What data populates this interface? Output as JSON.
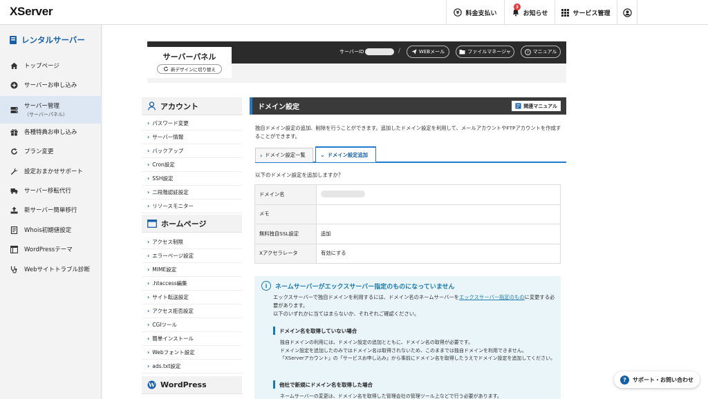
{
  "app": {
    "logo": "XServer"
  },
  "topbar": {
    "payment_label": "料金支払い",
    "notice_label": "お知らせ",
    "notice_count": "3",
    "service_label": "サービス管理"
  },
  "sidebar": {
    "title": "レンタルサーバー",
    "items": [
      {
        "label": "トップページ",
        "icon": "home-icon"
      },
      {
        "label": "サーバーお申し込み",
        "icon": "plus-circle-icon"
      },
      {
        "label": "サーバー管理",
        "sub": "（サーバーパネル）",
        "icon": "server-icon",
        "active": true
      },
      {
        "label": "各種特典お申し込み",
        "icon": "gift-icon"
      },
      {
        "label": "プラン変更",
        "icon": "refresh-icon"
      },
      {
        "label": "設定おまかせサポート",
        "icon": "wrench-icon"
      },
      {
        "label": "サーバー移転代行",
        "icon": "truck-icon"
      },
      {
        "label": "新サーバー簡単移行",
        "icon": "upload-icon"
      },
      {
        "label": "Whois初期値設定",
        "icon": "document-icon"
      },
      {
        "label": "WordPressテーマ",
        "icon": "layout-icon"
      },
      {
        "label": "Webサイトトラブル診断",
        "icon": "stethoscope-icon"
      }
    ]
  },
  "panel": {
    "title": "サーバーパネル",
    "new_design": "新デザインに切り替え",
    "server_id_label": "サーバーID",
    "webmail": "WEBメール",
    "file_manager": "ファイルマネージャ",
    "manual": "マニュアル"
  },
  "leftnav": {
    "account": {
      "title": "アカウント",
      "links": [
        "パスワード変更",
        "サーバー情報",
        "バックアップ",
        "Cron設定",
        "SSH設定",
        "二段階認証設定",
        "リソースモニター"
      ]
    },
    "homepage": {
      "title": "ホームページ",
      "links": [
        "アクセス制限",
        "エラーページ設定",
        "MIME設定",
        ".htaccess編集",
        "サイト転送設定",
        "アクセス拒否設定",
        "CGIツール",
        "簡単インストール",
        "Webフォント設定",
        "ads.txt設定"
      ]
    },
    "wordpress": {
      "title": "WordPress"
    }
  },
  "domain": {
    "heading": "ドメイン設定",
    "manual_link": "関連マニュアル",
    "intro": "独自ドメイン設定の追加、削除を行うことができます。追加したドメイン設定を利用して、メールアカウントやFTPアカウントを作成することができます。",
    "tabs": [
      "ドメイン設定一覧",
      "ドメイン設定追加"
    ],
    "question": "以下のドメイン設定を追加しますか？",
    "rows": [
      {
        "label": "ドメイン名",
        "value": ""
      },
      {
        "label": "メモ",
        "value": ""
      },
      {
        "label": "無料独自SSL設定",
        "value": "追加"
      },
      {
        "label": "Xアクセラレータ",
        "value": "有効にする"
      }
    ]
  },
  "notice": {
    "title": "ネームサーバーがエックスサーバー指定のものになっていません",
    "p1_before": "エックスサーバーで独自ドメインを利用するには、ドメイン名のネームサーバーを",
    "p1_link": "エックスサーバー指定のもの",
    "p1_after": "に変更する必要があります。",
    "p1_line2": "以下のいずれかに当てはまらないか、それぞれご確認ください。",
    "sub1": "ドメイン名を取得していない場合",
    "p2_line1": "独自ドメインの利用には、ドメイン設定の追加とともに、ドメイン名の取得が必要です。",
    "p2_line2": "ドメイン設定を追加したのみではドメイン名は取得されないため、このままでは独自ドメインを利用できません。",
    "p2_line3": "「XServerアカウント」の「サービスお申し込み」から事前にドメイン名を取得したうえでドメイン設定を追加してください。",
    "sub2": "他社で新規にドメイン名を取得した場合",
    "p3": "ネームサーバーの変更は、ドメイン名を取得した管理会社の管理ツール上などで行う必要があります。"
  },
  "support": {
    "label": "サポート・お問い合わせ"
  }
}
